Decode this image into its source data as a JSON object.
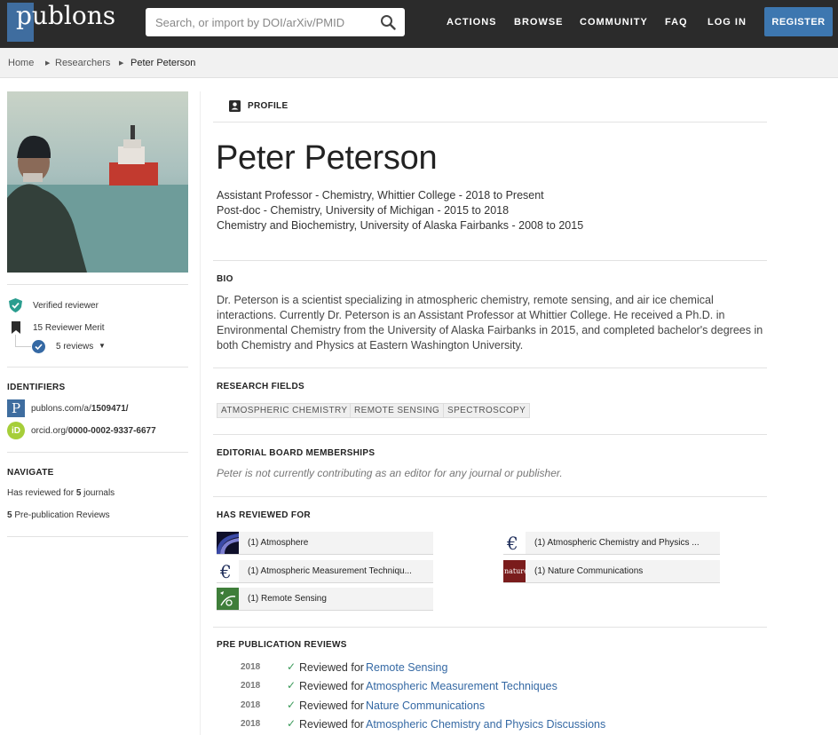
{
  "header": {
    "logo_text": "publons",
    "search_placeholder": "Search, or import by DOI/arXiv/PMID",
    "nav": [
      "ACTIONS",
      "BROWSE",
      "COMMUNITY",
      "FAQ",
      "LOG IN"
    ],
    "register_label": "REGISTER",
    "brand_color": "#3f6d9f"
  },
  "breadcrumb": [
    "Home",
    "Researchers",
    "Peter Peterson"
  ],
  "sidebar": {
    "badges": {
      "verified": "Verified reviewer",
      "merit": "15 Reviewer Merit",
      "reviews": "5 reviews"
    },
    "identifiers_title": "IDENTIFIERS",
    "publons_prefix": "publons.com/a/",
    "publons_id": "1509471/",
    "orcid_prefix": "orcid.org/",
    "orcid_id": "0000-0002-9337-6677",
    "navigate_title": "NAVIGATE",
    "nav_journals_pre": "Has reviewed for ",
    "nav_journals_count": "5",
    "nav_journals_post": " journals",
    "nav_prepub_count": "5",
    "nav_prepub_post": " Pre-publication Reviews"
  },
  "profile": {
    "tab_label": "PROFILE",
    "name": "Peter Peterson",
    "positions": [
      "Assistant Professor - Chemistry, Whittier College - 2018 to Present",
      "Post-doc - Chemistry, University of Michigan - 2015 to 2018",
      "Chemistry and Biochemistry, University of Alaska Fairbanks - 2008 to 2015"
    ],
    "bio_title": "BIO",
    "bio": "Dr. Peterson is a scientist specializing in atmospheric chemistry, remote sensing, and air ice chemical interactions. Currently Dr. Peterson is an Assistant Professor at Whittier College. He received a Ph.D. in Environmental Chemistry from the University of Alaska Fairbanks in 2015, and completed bachelor's degrees in both Chemistry and Physics at Eastern Washington University.",
    "fields_title": "RESEARCH FIELDS",
    "fields": [
      "ATMOSPHERIC CHEMISTRY",
      "REMOTE SENSING",
      "SPECTROSCOPY"
    ],
    "editorial_title": "EDITORIAL BOARD MEMBERSHIPS",
    "editorial_text": "Peter is not currently contributing as an editor for any journal or publisher.",
    "reviewed_title": "HAS REVIEWED FOR",
    "journals": [
      "(1) Atmosphere",
      "(1) Atmospheric Chemistry and Physics ...",
      "(1) Atmospheric Measurement Techniqu...",
      "(1) Nature Communications",
      "(1) Remote Sensing"
    ],
    "nature_logo_text": "nature",
    "prepub_title": "PRE PUBLICATION REVIEWS",
    "reviews": [
      {
        "year": "2018",
        "label": "Reviewed for",
        "journal": "Remote Sensing"
      },
      {
        "year": "2018",
        "label": "Reviewed for",
        "journal": "Atmospheric Measurement Techniques"
      },
      {
        "year": "2018",
        "label": "Reviewed for",
        "journal": "Nature Communications"
      },
      {
        "year": "2018",
        "label": "Reviewed for",
        "journal": "Atmospheric Chemistry and Physics Discussions"
      }
    ]
  }
}
